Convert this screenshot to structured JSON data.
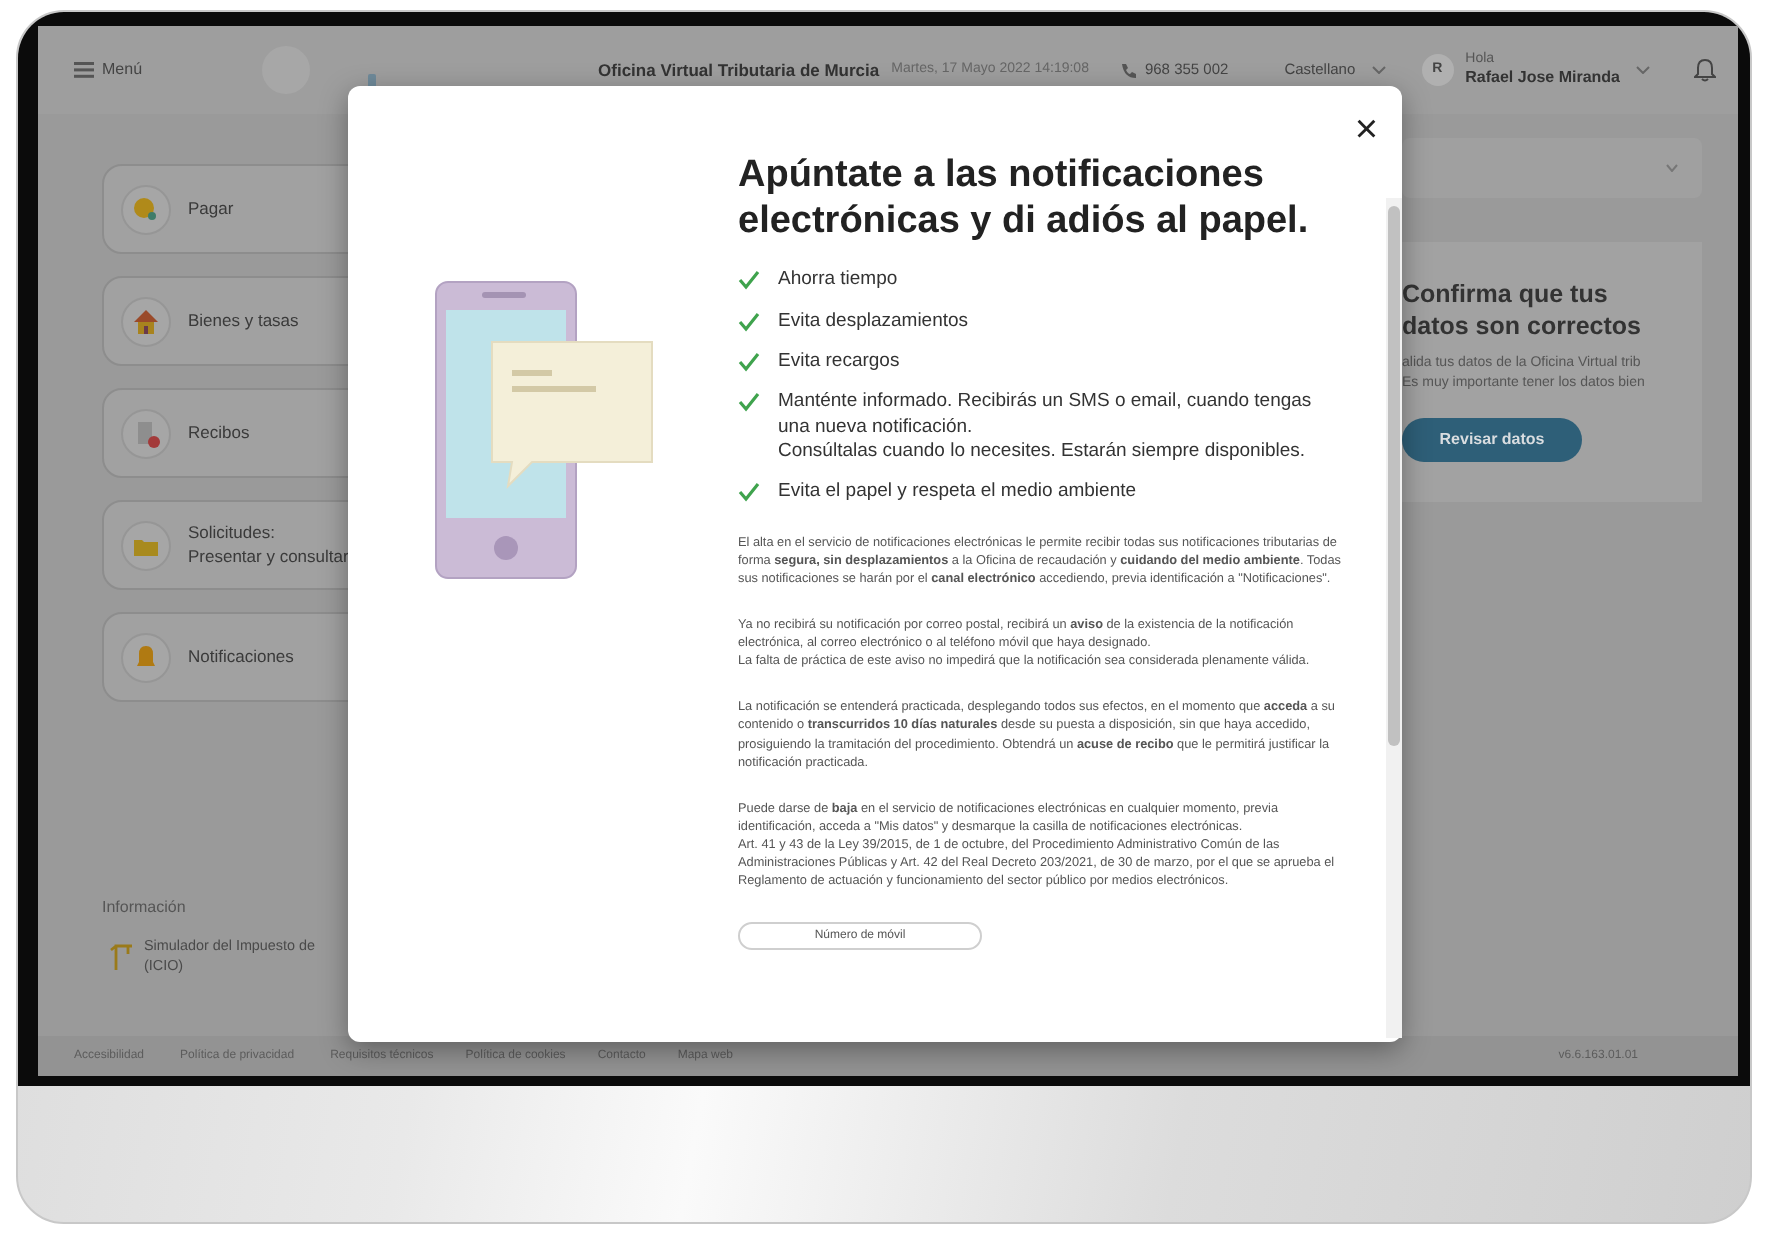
{
  "topbar": {
    "menu_label": "Menú",
    "site_title": "Oficina Virtual Tributaria de Murcia",
    "datetime": "Martes, 17 Mayo 2022 14:19:08",
    "phone": "968 355 002",
    "language": "Castellano",
    "avatar_initial": "R",
    "greeting": "Hola",
    "user_name": "Rafael Jose Miranda"
  },
  "sidebar": {
    "items": [
      {
        "kind": "coin",
        "lines": [
          "Pagar"
        ]
      },
      {
        "kind": "house",
        "lines": [
          "Bienes y tasas"
        ]
      },
      {
        "kind": "receipt",
        "lines": [
          "Recibos"
        ]
      },
      {
        "kind": "folder",
        "lines": [
          "Solicitudes:",
          "Presentar y consultar"
        ]
      },
      {
        "kind": "bell",
        "lines": [
          "Notificaciones"
        ]
      }
    ],
    "info_heading": "Información",
    "info_link": {
      "lines": [
        "Simulador del Impuesto de",
        "(ICIO)"
      ]
    }
  },
  "confirm_card": {
    "title_lines": [
      "Confirma que tus",
      "datos son correctos"
    ],
    "text_lines": [
      "alida tus datos de la Oficina Virtual trib",
      "Es muy importante tener los datos bien"
    ],
    "button": "Revisar datos"
  },
  "modal": {
    "close": "×",
    "title": "Apúntate a las notificaciones electrónicas y di adiós al papel.",
    "benefits": [
      {
        "lines": [
          "Ahorra tiempo"
        ]
      },
      {
        "lines": [
          "Evita desplazamientos"
        ]
      },
      {
        "lines": [
          "Evita recargos"
        ]
      },
      {
        "lines": [
          "Manténte informado. Recibirás un SMS o email, cuando tengas una nueva notificación.",
          "Consúltalas cuando lo necesites. Estarán siempre disponibles."
        ]
      },
      {
        "lines": [
          "Evita el papel y respeta el medio ambiente"
        ]
      }
    ],
    "paragraphs": [
      {
        "lines": [
          "El alta en el servicio de notificaciones electrónicas le permite recibir todas sus notificaciones tributarias de forma **segura, sin desplazamientos** a la Oficina de recaudación y **cuidando del medio ambiente**. Todas sus notificaciones se harán por el **canal electrónico** accediendo, previa identificación a \"Notificaciones\"."
        ]
      },
      {
        "lines": [
          "Ya no recibirá su notificación por correo postal, recibirá un **aviso** de la existencia de la notificación electrónica, al correo electrónico o al teléfono móvil que haya designado.",
          "La falta de práctica de este aviso no impedirá que la notificación sea considerada plenamente válida."
        ]
      },
      {
        "lines": [
          "La notificación se entenderá practicada, desplegando todos sus efectos, en el momento que **acceda** a su contenido o **transcurridos 10 días naturales** desde su puesta a disposición, sin que haya accedido, prosiguiendo la tramitación del procedimiento. Obtendrá un **acuse de recibo** que le permitirá justificar la notificación practicada."
        ]
      },
      {
        "lines": [
          "Puede darse de **baja** en el servicio de notificaciones electrónicas en cualquier momento, previa identificación, acceda a \"Mis datos\" y desmarque la casilla de notificaciones electrónicas.",
          "Art. 41 y 43 de la Ley 39/2015, de 1 de octubre, del Procedimiento Administrativo Común de las Administraciones Públicas y Art. 42 del Real Decreto 203/2021, de 30 de marzo, por el que se aprueba el Reglamento de actuación y funcionamiento del sector público por medios electrónicos."
        ]
      }
    ],
    "mobile_button": "Número de móvil"
  },
  "footer": {
    "links": [
      "Accesibilidad",
      "Política de privacidad",
      "Requisitos técnicos",
      "Política de cookies",
      "Contacto",
      "Mapa web"
    ],
    "version": "v6.6.163.01.01"
  }
}
